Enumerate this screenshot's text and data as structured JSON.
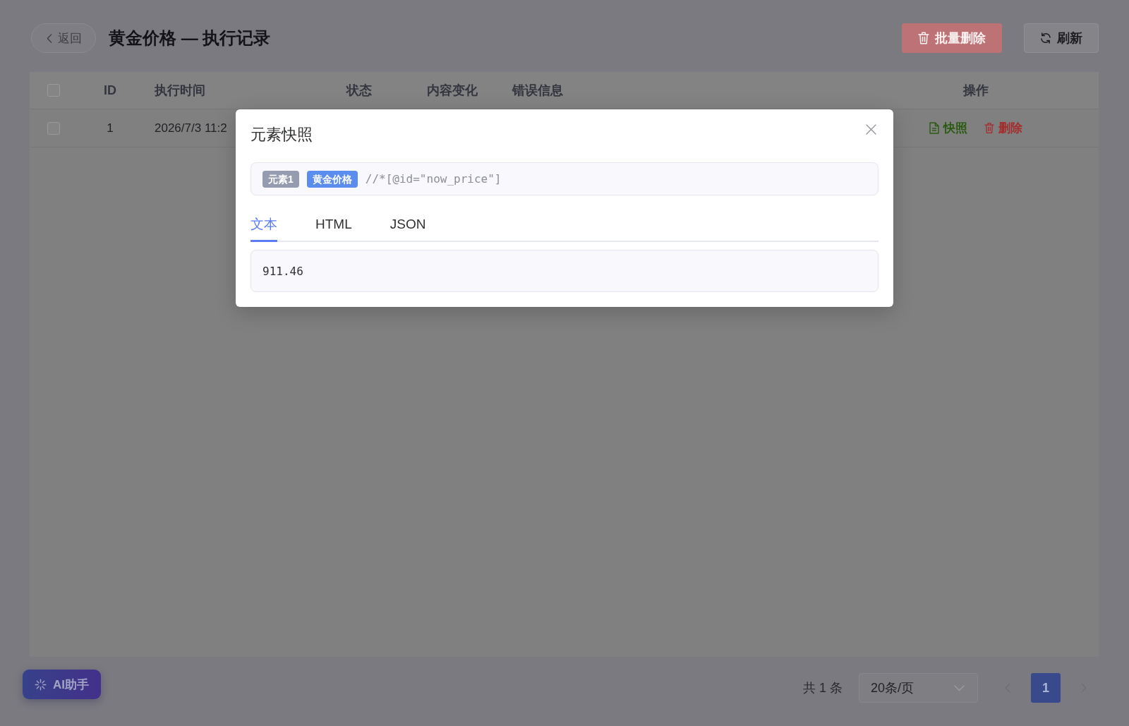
{
  "header": {
    "back_button": {
      "label": "返回"
    },
    "title": "黄金价格 — 执行记录",
    "actions": [
      {
        "label": "批量删除",
        "kind": "danger",
        "disabled": true
      },
      {
        "label": "刷新",
        "kind": "default",
        "disabled": false
      }
    ]
  },
  "table": {
    "select_all": {
      "checked": false
    },
    "columns": [
      "ID",
      "执行时间",
      "状态",
      "内容变化",
      "错误信息",
      "操作"
    ],
    "rows": [
      {
        "checked": false,
        "id": "1",
        "time": "2026/7/3 11:2",
        "actions": [
          {
            "label": "快照",
            "kind": "snapshot"
          },
          {
            "label": "删除",
            "kind": "delete"
          }
        ]
      }
    ]
  },
  "dialog": {
    "title": "元素快照",
    "tags": [
      {
        "label": "元素1",
        "color": "#959cb0"
      },
      {
        "label": "黄金价格",
        "color": "#5b8def"
      }
    ],
    "xpath": "//*[@id=\"now_price\"]",
    "tabs": [
      {
        "label": "文本",
        "selected": true
      },
      {
        "label": "HTML",
        "selected": false
      },
      {
        "label": "JSON",
        "selected": false
      }
    ],
    "content": "911.46"
  },
  "assistant_button": {
    "label": "AI助手"
  },
  "pagination": {
    "total": "共 1 条",
    "page_size": "20条/页",
    "pages": [
      {
        "label": "1",
        "selected": true
      }
    ]
  }
}
